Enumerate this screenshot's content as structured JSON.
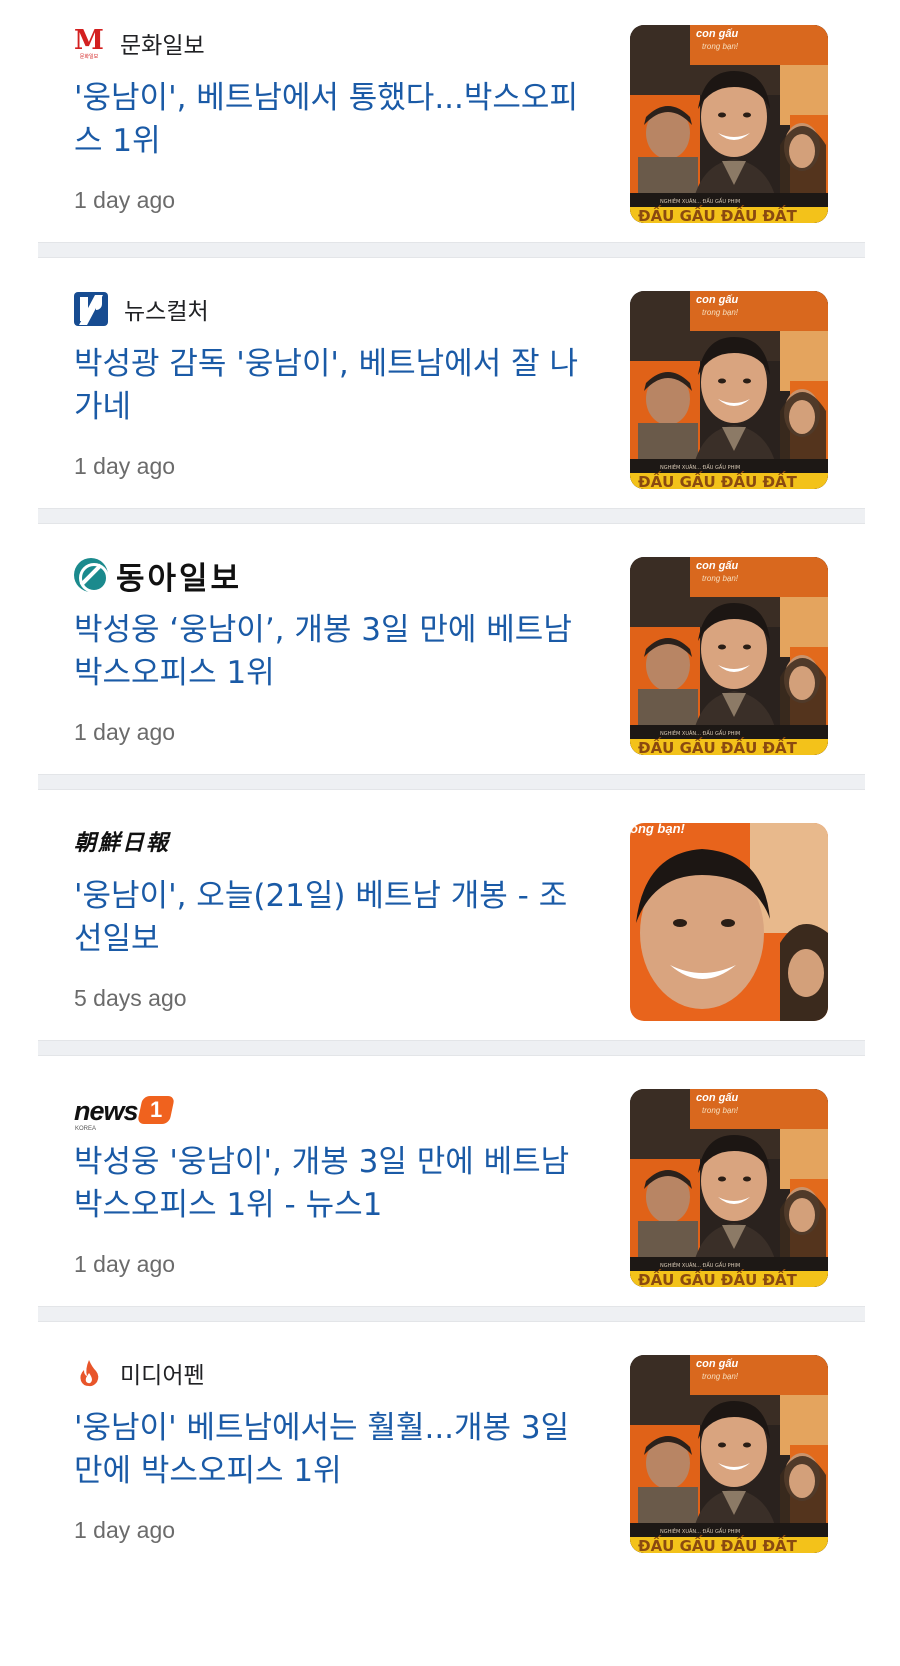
{
  "articles": [
    {
      "source": "문화일보",
      "logo_icon": "munhwa-m-logo-icon",
      "logo_text": "M",
      "logo_subtext": "문화일보",
      "headline": "'웅남이', 베트남에서 통했다...박스오피스 1위",
      "time": "1 day ago",
      "thumbnail": "movie-poster-thumbnail",
      "thumb_caption": "con gấu",
      "thumb_caption2": "trong bạn!"
    },
    {
      "source": "뉴스컬처",
      "logo_icon": "newsculture-logo-icon",
      "headline": "박성광 감독 '웅남이', 베트남에서 잘 나가네",
      "time": "1 day ago",
      "thumbnail": "movie-poster-thumbnail",
      "thumb_caption": "con gấu",
      "thumb_caption2": "trong bạn!"
    },
    {
      "source": "동아일보",
      "logo_icon": "donga-logo-icon",
      "headline": "박성웅 ‘웅남이’, 개봉 3일 만에 베트남 박스오피스 1위",
      "time": "1 day ago",
      "thumbnail": "movie-poster-thumbnail",
      "thumb_caption": "con gấu",
      "thumb_caption2": "trong bạn!"
    },
    {
      "source": "朝鮮日報",
      "logo_icon": "chosun-logo-icon",
      "headline": "'웅남이', 오늘(21일) 베트남 개봉 - 조선일보",
      "time": "5 days ago",
      "thumbnail": "movie-poster-closeup-thumbnail",
      "thumb_caption": "ong bạn!",
      "thumb_caption2": ""
    },
    {
      "source": "news1",
      "logo_icon": "news1-logo-icon",
      "logo_text": "news",
      "logo_badge": "1",
      "logo_subtext": "KOREA",
      "headline": "박성웅 '웅남이', 개봉 3일 만에 베트남 박스오피스 1위 - 뉴스1",
      "time": "1 day ago",
      "thumbnail": "movie-poster-thumbnail",
      "thumb_caption": "con gấu",
      "thumb_caption2": "trong bạn!"
    },
    {
      "source": "미디어펜",
      "logo_icon": "flame-logo-icon",
      "headline": "'웅남이' 베트남에서는 훨훨...개봉 3일 만에 박스오피스 1위",
      "time": "1 day ago",
      "thumbnail": "movie-poster-thumbnail",
      "thumb_caption": "con gấu",
      "thumb_caption2": "trong bạn!"
    }
  ],
  "colors": {
    "headline": "#1a5aa6",
    "divider": "#eef0f3",
    "meta": "#6b6b6b",
    "poster_orange": "#e8641c",
    "poster_yellow": "#f3c21a"
  }
}
